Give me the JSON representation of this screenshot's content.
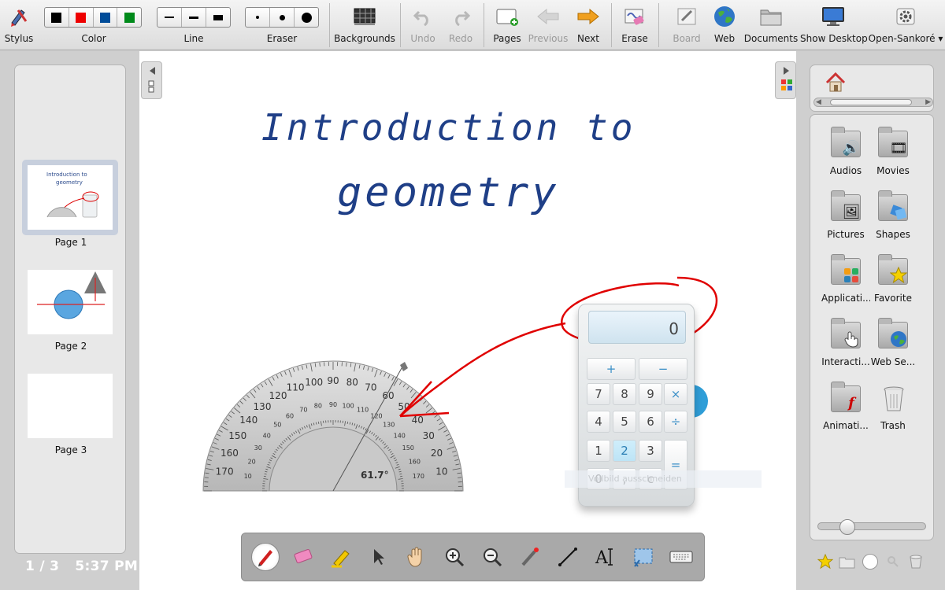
{
  "toolbar": {
    "stylus": "Stylus",
    "color": "Color",
    "line": "Line",
    "eraser": "Eraser",
    "backgrounds": "Backgrounds",
    "undo": "Undo",
    "redo": "Redo",
    "pages": "Pages",
    "previous": "Previous",
    "next": "Next",
    "erase": "Erase",
    "board": "Board",
    "web": "Web",
    "documents": "Documents",
    "show_desktop": "Show Desktop",
    "open_sankore": "Open-Sankoré",
    "colors": [
      "#000000",
      "#ee0000",
      "#004c99",
      "#008a1a"
    ]
  },
  "pages_panel": {
    "pages": [
      {
        "label": "Page 1",
        "selected": true
      },
      {
        "label": "Page 2",
        "selected": false
      },
      {
        "label": "Page 3",
        "selected": false
      }
    ],
    "page_counter": "1 / 3",
    "clock": "5:37 PM"
  },
  "board": {
    "title_line1": "Introduction to",
    "title_line2": "geometry",
    "protractor": {
      "angle": "61.7°",
      "outer_ticks": [
        "170",
        "160",
        "150",
        "140",
        "130",
        "120",
        "110",
        "100",
        "90",
        "80",
        "70",
        "60",
        "50",
        "40",
        "30",
        "20",
        "10"
      ],
      "inner_ticks": [
        "10",
        "20",
        "30",
        "40",
        "50",
        "60",
        "70",
        "80",
        "90",
        "100",
        "110",
        "120",
        "130",
        "140",
        "150",
        "160",
        "170"
      ]
    },
    "calculator": {
      "display": "0",
      "keys": [
        "+",
        "−",
        "7",
        "8",
        "9",
        "×",
        "4",
        "5",
        "6",
        "÷",
        "1",
        "2",
        "3",
        "=",
        "0",
        ",",
        "c"
      ]
    },
    "cut_label": "Vollbild ausschneiden"
  },
  "library": {
    "items": [
      {
        "label": "Audios",
        "icon": "audio-icon"
      },
      {
        "label": "Movies",
        "icon": "movie-icon"
      },
      {
        "label": "Pictures",
        "icon": "picture-icon"
      },
      {
        "label": "Shapes",
        "icon": "shapes-icon"
      },
      {
        "label": "Applicati...",
        "icon": "applications-icon"
      },
      {
        "label": "Favorite",
        "icon": "favorite-icon"
      },
      {
        "label": "Interacti...",
        "icon": "interactive-icon"
      },
      {
        "label": "Web Se...",
        "icon": "web-search-icon"
      },
      {
        "label": "Animati...",
        "icon": "animation-icon"
      },
      {
        "label": "Trash",
        "icon": "trash-icon"
      }
    ],
    "zoom_level": 0.2
  },
  "dock_tools": [
    "pen-tool",
    "eraser-tool",
    "marker-tool",
    "selector-tool",
    "hand-tool",
    "zoom-in-tool",
    "zoom-out-tool",
    "laser-pointer-tool",
    "line-tool",
    "text-tool",
    "capture-tool",
    "keyboard-tool"
  ]
}
